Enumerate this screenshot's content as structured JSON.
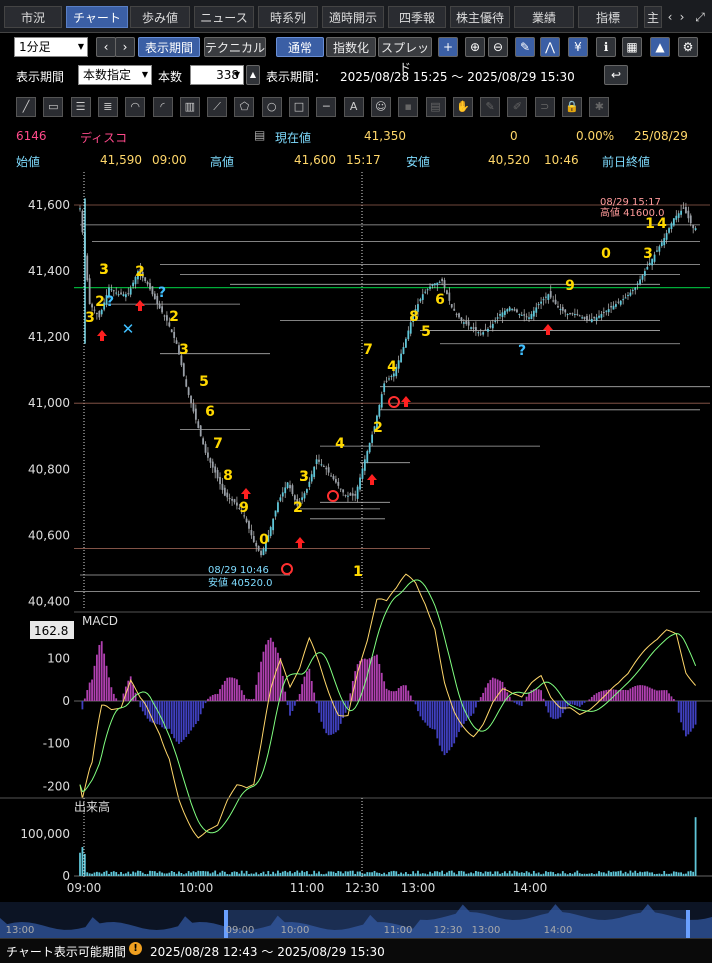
{
  "tabs": [
    "市況",
    "チャート",
    "歩み値",
    "ニュース",
    "時系列",
    "適時開示",
    "四季報",
    "株主優待",
    "業績",
    "指標",
    "主"
  ],
  "toolbar1": {
    "interval": "1分足",
    "period_button": "表示期間",
    "technical_button": "テクニカル",
    "normal_button": "通常",
    "index_button": "指数化",
    "spread_button": "スプレッド"
  },
  "toolbar2": {
    "period_label": "表示期間",
    "period_mode": "本数指定",
    "count_label": "本数",
    "count_value": "338",
    "range_label": "表示期間：",
    "range_value": "2025/08/28 15:25 ～ 2025/08/29 15:30"
  },
  "quote": {
    "code": "6146",
    "name": "ディスコ",
    "current_label": "現在値",
    "current_value": "41,350",
    "change": "0",
    "change_pct": "0.00%",
    "date": "25/08/29",
    "open_label": "始値",
    "open_value": "41,590",
    "open_time": "09:00",
    "high_label": "高値",
    "high_value": "41,600",
    "high_time": "15:17",
    "low_label": "安値",
    "low_value": "40,520",
    "low_time": "10:46",
    "prev_close_label": "前日終値"
  },
  "chart_data": {
    "type": "candlestick",
    "price_axis": {
      "ticks": [
        "41,600",
        "41,400",
        "41,200",
        "41,000",
        "40,800",
        "40,600",
        "40,400"
      ],
      "values": [
        41600,
        41400,
        41200,
        41000,
        40800,
        40600,
        40400
      ],
      "ylim": [
        40380,
        41700
      ]
    },
    "time_axis": {
      "ticks": [
        "09:00",
        "10:00",
        "11:00",
        "12:30",
        "13:00",
        "14:00"
      ]
    },
    "close_path": [
      [
        0,
        41590
      ],
      [
        4,
        41300
      ],
      [
        8,
        41260
      ],
      [
        12,
        41350
      ],
      [
        16,
        41330
      ],
      [
        20,
        41330
      ],
      [
        24,
        41400
      ],
      [
        28,
        41360
      ],
      [
        32,
        41300
      ],
      [
        36,
        41250
      ],
      [
        40,
        41180
      ],
      [
        44,
        41050
      ],
      [
        48,
        40950
      ],
      [
        52,
        40850
      ],
      [
        56,
        40790
      ],
      [
        60,
        40720
      ],
      [
        64,
        40700
      ],
      [
        68,
        40660
      ],
      [
        72,
        40580
      ],
      [
        75,
        40540
      ],
      [
        78,
        40600
      ],
      [
        82,
        40700
      ],
      [
        86,
        40760
      ],
      [
        90,
        40690
      ],
      [
        94,
        40740
      ],
      [
        98,
        40830
      ],
      [
        102,
        40800
      ],
      [
        106,
        40760
      ],
      [
        110,
        40720
      ],
      [
        114,
        40720
      ],
      [
        118,
        40830
      ],
      [
        122,
        40930
      ],
      [
        126,
        41060
      ],
      [
        130,
        41090
      ],
      [
        134,
        41170
      ],
      [
        138,
        41270
      ],
      [
        142,
        41330
      ],
      [
        146,
        41360
      ],
      [
        150,
        41370
      ],
      [
        154,
        41290
      ],
      [
        158,
        41250
      ],
      [
        162,
        41230
      ],
      [
        166,
        41210
      ],
      [
        170,
        41230
      ],
      [
        174,
        41270
      ],
      [
        178,
        41290
      ],
      [
        182,
        41270
      ],
      [
        186,
        41260
      ],
      [
        190,
        41300
      ],
      [
        194,
        41330
      ],
      [
        198,
        41290
      ],
      [
        202,
        41270
      ],
      [
        206,
        41270
      ],
      [
        210,
        41250
      ],
      [
        214,
        41260
      ],
      [
        218,
        41280
      ],
      [
        222,
        41300
      ],
      [
        226,
        41320
      ],
      [
        230,
        41350
      ],
      [
        234,
        41400
      ],
      [
        238,
        41450
      ],
      [
        242,
        41500
      ],
      [
        246,
        41560
      ],
      [
        250,
        41590
      ],
      [
        254,
        41530
      ]
    ],
    "high_annotation": {
      "time": "08/29 15:17",
      "label": "高値",
      "value": "41600.0"
    },
    "low_annotation": {
      "time": "08/29 10:46",
      "label": "安値",
      "value": "40520.0"
    },
    "count_labels": [
      "3",
      "2",
      "3",
      "3",
      "2",
      "2",
      "3",
      "5",
      "6",
      "7",
      "8",
      "9",
      "0",
      "1",
      "2",
      "2",
      "3",
      "4",
      "1",
      "2",
      "3",
      "4",
      "7",
      "8",
      "5",
      "6",
      "9",
      "0",
      "3",
      "1",
      "4"
    ],
    "macd": {
      "label": "MACD",
      "current": "162.8",
      "ticks": [
        "100",
        "0",
        "-100",
        "-200"
      ],
      "values": [
        100,
        0,
        -100,
        -200
      ]
    },
    "volume": {
      "label": "出来高",
      "ticks": [
        "100,000",
        "0"
      ],
      "values": [
        100000,
        0
      ]
    },
    "navigator_ticks": [
      "13:00",
      "09:00",
      "10:00",
      "11:00",
      "12:30",
      "13:00",
      "14:00"
    ]
  },
  "footer": {
    "label": "チャート表示可能期間",
    "warning": "!",
    "range": "2025/08/28 12:43 ～ 2025/08/29 15:30"
  },
  "colors": {
    "up_arrow": "#ff2020",
    "count_label": "#ffd800",
    "macd_line": "#ffd76a",
    "signal_line": "#80ff80",
    "accent_blue": "#3b5fa5"
  }
}
